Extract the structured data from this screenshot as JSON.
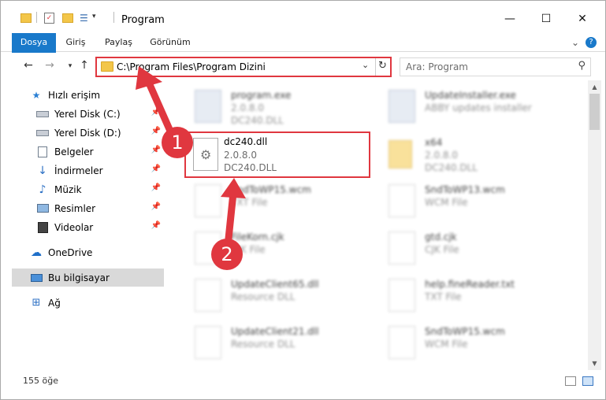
{
  "window": {
    "title": "Program",
    "colors": {
      "accent": "#1979ca",
      "annotation": "#e0373f"
    }
  },
  "ribbon": {
    "tabs": [
      "Dosya",
      "Giriş",
      "Paylaş",
      "Görünüm"
    ]
  },
  "address": {
    "path": "C:\\Program Files\\Program Dizini",
    "search_placeholder": "Ara: Program"
  },
  "sidebar": {
    "quick_access_label": "Hızlı erişim",
    "items": [
      {
        "label": "Yerel Disk (C:)",
        "icon": "drive-icon",
        "pinned": true
      },
      {
        "label": "Yerel Disk (D:)",
        "icon": "drive-icon",
        "pinned": true
      },
      {
        "label": "Belgeler",
        "icon": "documents-icon",
        "pinned": true
      },
      {
        "label": "İndirmeler",
        "icon": "downloads-icon",
        "pinned": true
      },
      {
        "label": "Müzik",
        "icon": "music-icon",
        "pinned": true
      },
      {
        "label": "Resimler",
        "icon": "pictures-icon",
        "pinned": true
      },
      {
        "label": "Videolar",
        "icon": "videos-icon",
        "pinned": true
      }
    ],
    "onedrive_label": "OneDrive",
    "this_pc_label": "Bu bilgisayar",
    "network_label": "Ağ"
  },
  "files": [
    {
      "name": "program.exe",
      "line2": "2.0.8.0",
      "line3": "DC240.DLL",
      "type": "exe"
    },
    {
      "name": "UpdateInstaller.exe",
      "line2": "ABBY updates installer",
      "line3": "",
      "type": "exe"
    },
    {
      "name": "x64",
      "line2": "2.0.8.0",
      "line3": "DC240.DLL",
      "type": "folder"
    },
    {
      "name": "SndToWP15.wcm",
      "line2": "TXT File",
      "line3": "",
      "type": "doc"
    },
    {
      "name": "SndToWP13.wcm",
      "line2": "WCM File",
      "line3": "",
      "type": "doc"
    },
    {
      "name": "FileKorn.cjk",
      "line2": "CJK File",
      "line3": "",
      "type": "doc"
    },
    {
      "name": "gtd.cjk",
      "line2": "CJK File",
      "line3": "",
      "type": "doc"
    },
    {
      "name": "UpdateClient65.dll",
      "line2": "Resource DLL",
      "line3": "",
      "type": "dll"
    },
    {
      "name": "help.fineReader.txt",
      "line2": "TXT File",
      "line3": "",
      "type": "doc"
    },
    {
      "name": "UpdateClient21.dll",
      "line2": "Resource DLL",
      "line3": "",
      "type": "dll"
    },
    {
      "name": "SndToWP15.wcm",
      "line2": "WCM File",
      "line3": "",
      "type": "doc"
    }
  ],
  "highlighted_file": {
    "name": "dc240.dll",
    "line2": "2.0.8.0",
    "line3": "DC240.DLL"
  },
  "status": {
    "count": "155 öğe"
  },
  "annotations": {
    "step1": "1",
    "step2": "2"
  }
}
